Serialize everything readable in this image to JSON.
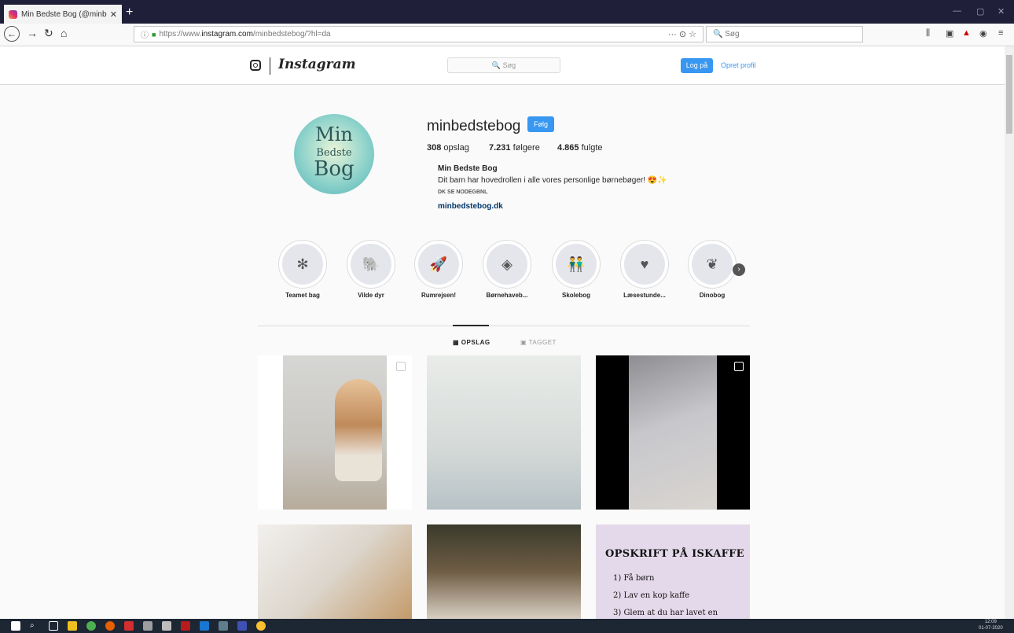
{
  "browser": {
    "tab_title": "Min Bedste Bog (@minbedsteb",
    "tab_close": "✕",
    "new_tab": "+",
    "url_scheme": "https://www.",
    "url_domain": "instagram.com",
    "url_path": "/minbedstebog/?hl=da",
    "url_icons": "··· ⊙ ☆",
    "search_placeholder": "Søg"
  },
  "instagram_header": {
    "wordmark": "Instagram",
    "search_placeholder": "Søg",
    "login_label": "Log på",
    "signup_label": "Opret profil"
  },
  "profile": {
    "username": "minbedstebog",
    "follow_label": "Følg",
    "posts_count": "308",
    "posts_label": "opslag",
    "followers_count": "7.231",
    "followers_label": "følgere",
    "following_count": "4.865",
    "following_label": "fulgte",
    "full_name": "Min Bedste Bog",
    "bio": "Dit barn har hovedrollen i alle vores personlige børnebøger! 😍✨",
    "category": "DK SE NODEGBNL",
    "website": "minbedstebog.dk",
    "avatar_text": [
      "Min",
      "Bedste",
      "Bog"
    ]
  },
  "highlights": [
    {
      "label": "Teamet bag",
      "icon": "✻"
    },
    {
      "label": "Vilde dyr",
      "icon": "🐘"
    },
    {
      "label": "Rumrejsen!",
      "icon": "🚀"
    },
    {
      "label": "Børnehaveb...",
      "icon": "◈"
    },
    {
      "label": "Skolebog",
      "icon": "👬"
    },
    {
      "label": "Læsestunde...",
      "icon": "♥"
    },
    {
      "label": "Dinobog",
      "icon": "❦"
    }
  ],
  "tabs": {
    "posts": "OPSLAG",
    "tagged": "TAGGET"
  },
  "recipe_post": {
    "title": "OPSKRIFT PÅ ISKAFFE",
    "items": [
      "1) Få børn",
      "2) Lav en kop kaffe",
      "3) Glem at du har lavet en"
    ]
  },
  "taskbar": {
    "time": "12:09",
    "date": "01-07-2020"
  }
}
